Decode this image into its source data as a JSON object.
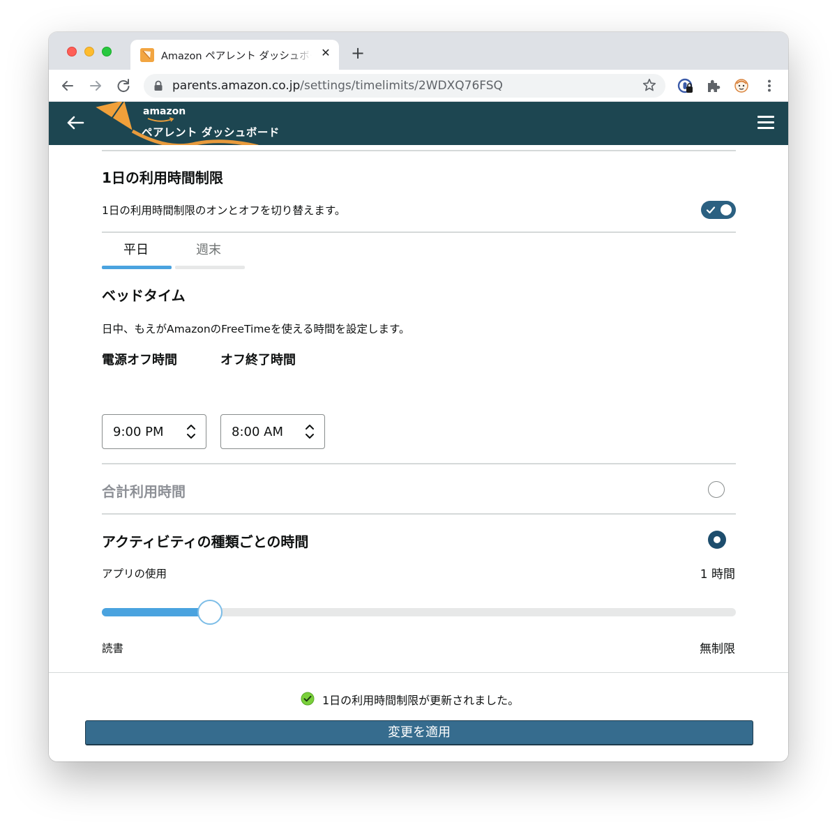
{
  "browser": {
    "tab_title": "Amazon ペアレント ダッシュボード",
    "close_glyph": "✕",
    "new_tab_glyph": "+",
    "url_host": "parents.amazon.co.jp",
    "url_path": "/settings/timelimits/2WDXQ76FSQ"
  },
  "header": {
    "brand_amazon": "amazon",
    "brand_title": "ペアレント ダッシュボード"
  },
  "daily_limit": {
    "title": "1日の利用時間制限",
    "description": "1日の利用時間制限のオンとオフを切り替えます。",
    "enabled": true
  },
  "day_tabs": [
    {
      "label": "平日",
      "selected": true
    },
    {
      "label": "週末",
      "selected": false
    }
  ],
  "bedtime": {
    "title": "ベッドタイム",
    "description": "日中、もえがAmazonのFreeTimeを使える時間を設定します。",
    "off_start_label": "電源オフ時間",
    "off_end_label": "オフ終了時間",
    "off_start_value": "9:00 PM",
    "off_end_value": "8:00 AM"
  },
  "total_time": {
    "title": "合計利用時間",
    "selected": false
  },
  "activity_time": {
    "title": "アクティビティの種類ごとの時間",
    "selected": true,
    "sliders": [
      {
        "label": "アプリの使用",
        "value_text": "1 時間",
        "level": 0.17
      },
      {
        "label": "読書",
        "value_text": "無制限",
        "level": 1.0
      }
    ]
  },
  "footer": {
    "status_text": "1日の利用時間制限が更新されました。",
    "apply_label": "変更を適用"
  },
  "colors": {
    "header_bg": "#1d4651",
    "accent_blue": "#4aa3df",
    "toggle_on": "#2b6081",
    "apply_button": "#366c8e",
    "success_green": "#7ad03a"
  }
}
